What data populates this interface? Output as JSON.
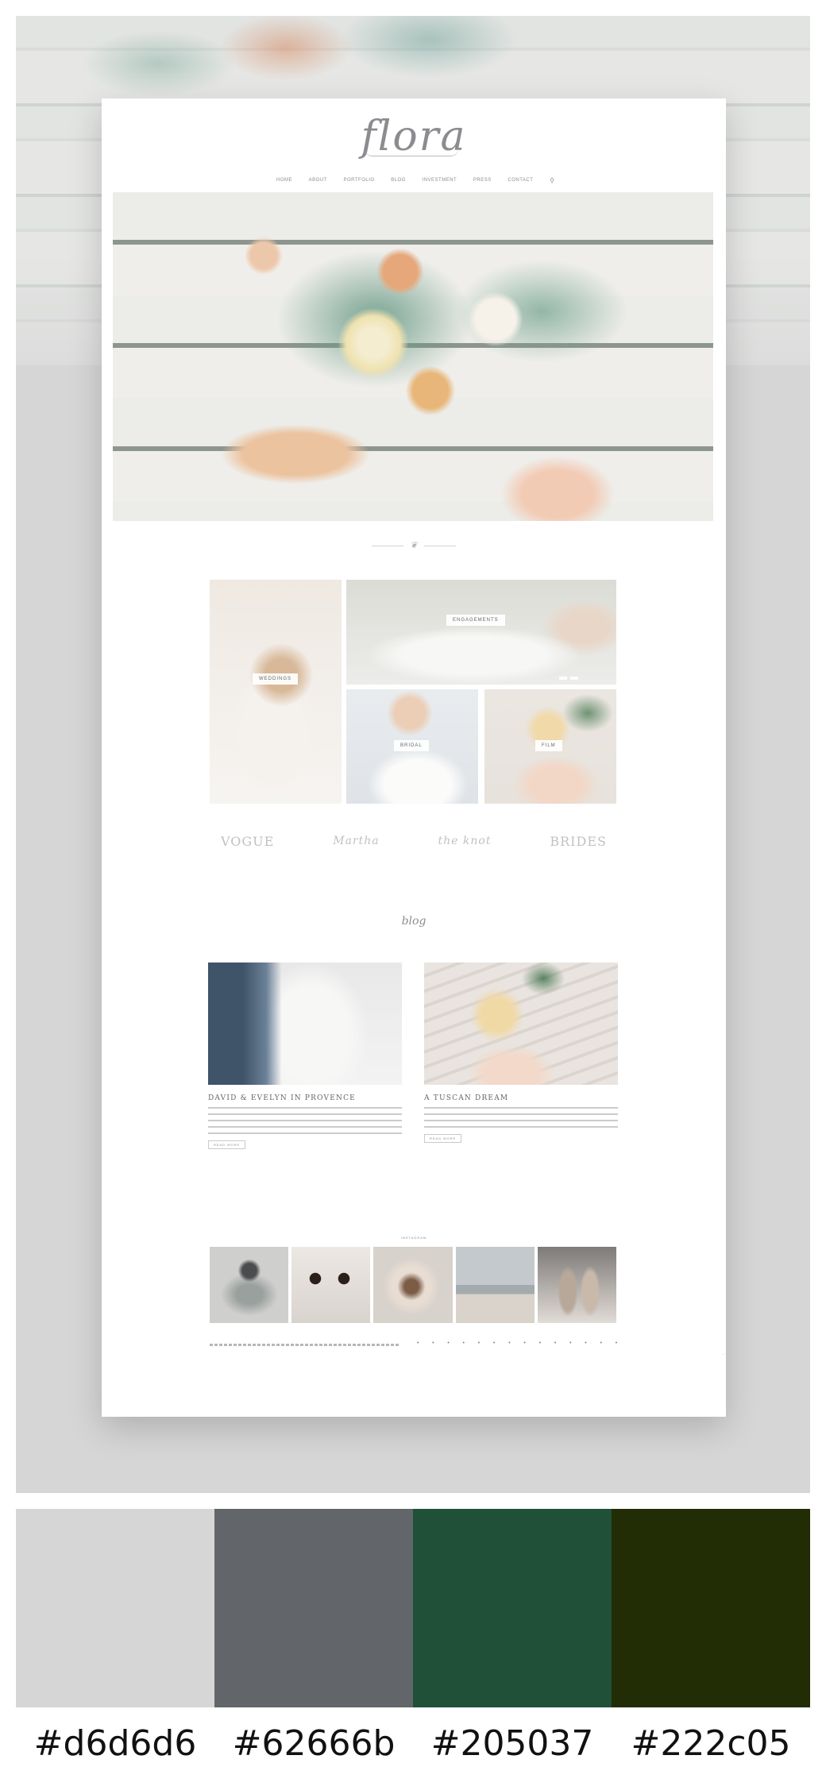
{
  "site": {
    "logo": "flora",
    "nav": [
      "HOME",
      "ABOUT",
      "PORTFOLIO",
      "BLOG",
      "INVESTMENT",
      "PRESS",
      "CONTACT"
    ],
    "search_icon": "search-icon"
  },
  "portfolio": {
    "tiles": [
      {
        "label": "WEDDINGS"
      },
      {
        "label": "ENGAGEMENTS"
      },
      {
        "label": "BRIDAL"
      },
      {
        "label": "FILM"
      }
    ]
  },
  "press": [
    "VOGUE",
    "Martha",
    "the knot",
    "BRIDES"
  ],
  "blog": {
    "heading": "blog",
    "posts": [
      {
        "title": "DAVID & EVELYN IN PROVENCE",
        "read_more": "READ MORE"
      },
      {
        "title": "A TUSCAN DREAM",
        "read_more": "READ MORE"
      }
    ]
  },
  "instagram": {
    "label": "INSTAGRAM"
  },
  "footer": {
    "social_icons": [
      "facebook-icon",
      "twitter-icon",
      "instagram-icon",
      "pinterest-icon",
      "bloglovin-icon",
      "google-icon",
      "tumblr-icon",
      "youtube-icon",
      "vimeo-icon",
      "linkedin-icon",
      "email-icon",
      "rss-icon",
      "etsy-icon",
      "snapchat-icon"
    ]
  },
  "palette": {
    "colors": [
      "#d6d6d6",
      "#62666b",
      "#205037",
      "#222c05"
    ],
    "codes": [
      "#d6d6d6",
      "#62666b",
      "#205037",
      "#222c05"
    ]
  }
}
